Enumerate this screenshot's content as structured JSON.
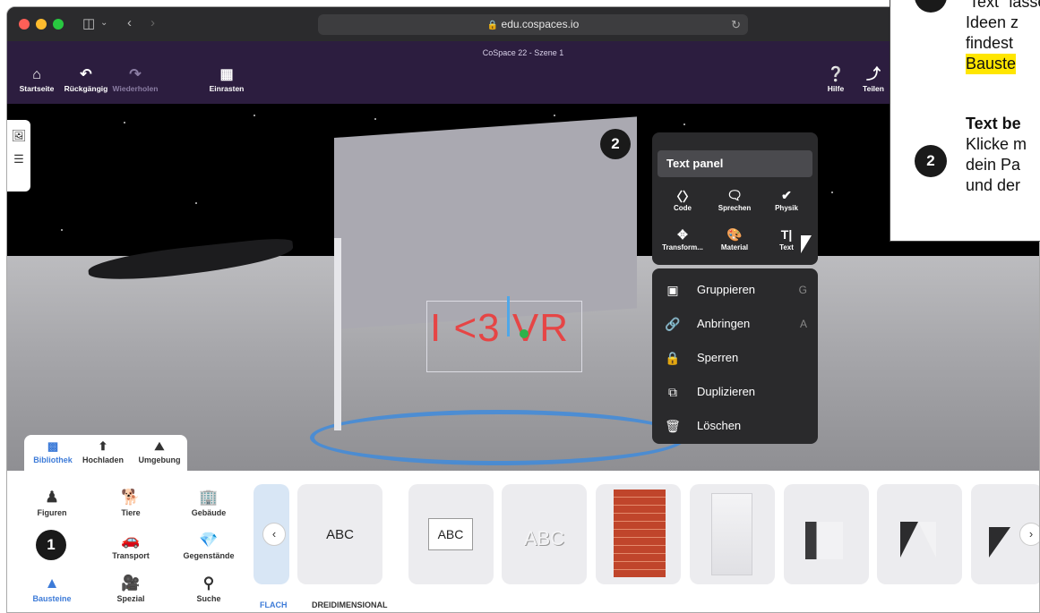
{
  "browser": {
    "url": "edu.cospaces.io",
    "colors": {
      "close": "#ff5f57",
      "minimize": "#febc2e",
      "zoom": "#28c840"
    }
  },
  "appbar": {
    "scene_title": "CoSpace 22 - Szene 1",
    "home": "Startseite",
    "undo": "Rückgängig",
    "redo": "Wiederholen",
    "snap": "Einrasten",
    "help": "Hilfe",
    "share": "Teilen"
  },
  "viewport": {
    "object_text": "I <3 VR",
    "badge": "2"
  },
  "text_panel": {
    "title": "Text panel",
    "buttons": [
      {
        "label": "Code",
        "icon": "code-icon"
      },
      {
        "label": "Sprechen",
        "icon": "speech-icon"
      },
      {
        "label": "Physik",
        "icon": "physics-icon"
      },
      {
        "label": "Transform...",
        "icon": "move-icon"
      },
      {
        "label": "Material",
        "icon": "palette-icon"
      },
      {
        "label": "Text",
        "icon": "text-cursor-icon"
      }
    ]
  },
  "context_menu": {
    "items": [
      {
        "label": "Gruppieren",
        "shortcut": "G"
      },
      {
        "label": "Anbringen",
        "shortcut": "A"
      },
      {
        "label": "Sperren",
        "shortcut": ""
      },
      {
        "label": "Duplizieren",
        "shortcut": ""
      },
      {
        "label": "Löschen",
        "shortcut": ""
      }
    ]
  },
  "library_tabs": {
    "library": "Bibliothek",
    "upload": "Hochladen",
    "environment": "Umgebung"
  },
  "categories": {
    "figures": "Figuren",
    "animals": "Tiere",
    "buildings": "Gebäude",
    "transport": "Transport",
    "items": "Gegenstände",
    "building_blocks": "Bausteine",
    "special": "Spezial",
    "search": "Suche",
    "badge": "1"
  },
  "items": {
    "abc1": "ABC",
    "abc2": "ABC",
    "abc3": "ABC"
  },
  "subtabs": {
    "flat": "FLACH",
    "three_d": "DREIDIMENSIONAL"
  },
  "instructions": {
    "line1": "Text\" lassen sich",
    "line2": "Ideen z",
    "line3": "findest",
    "line4": "Bauste",
    "step2_badge": "2",
    "step2_title": "Text be",
    "step2_line1": "Klicke m",
    "step2_line2": "dein Pa",
    "step2_line3": "und der"
  }
}
